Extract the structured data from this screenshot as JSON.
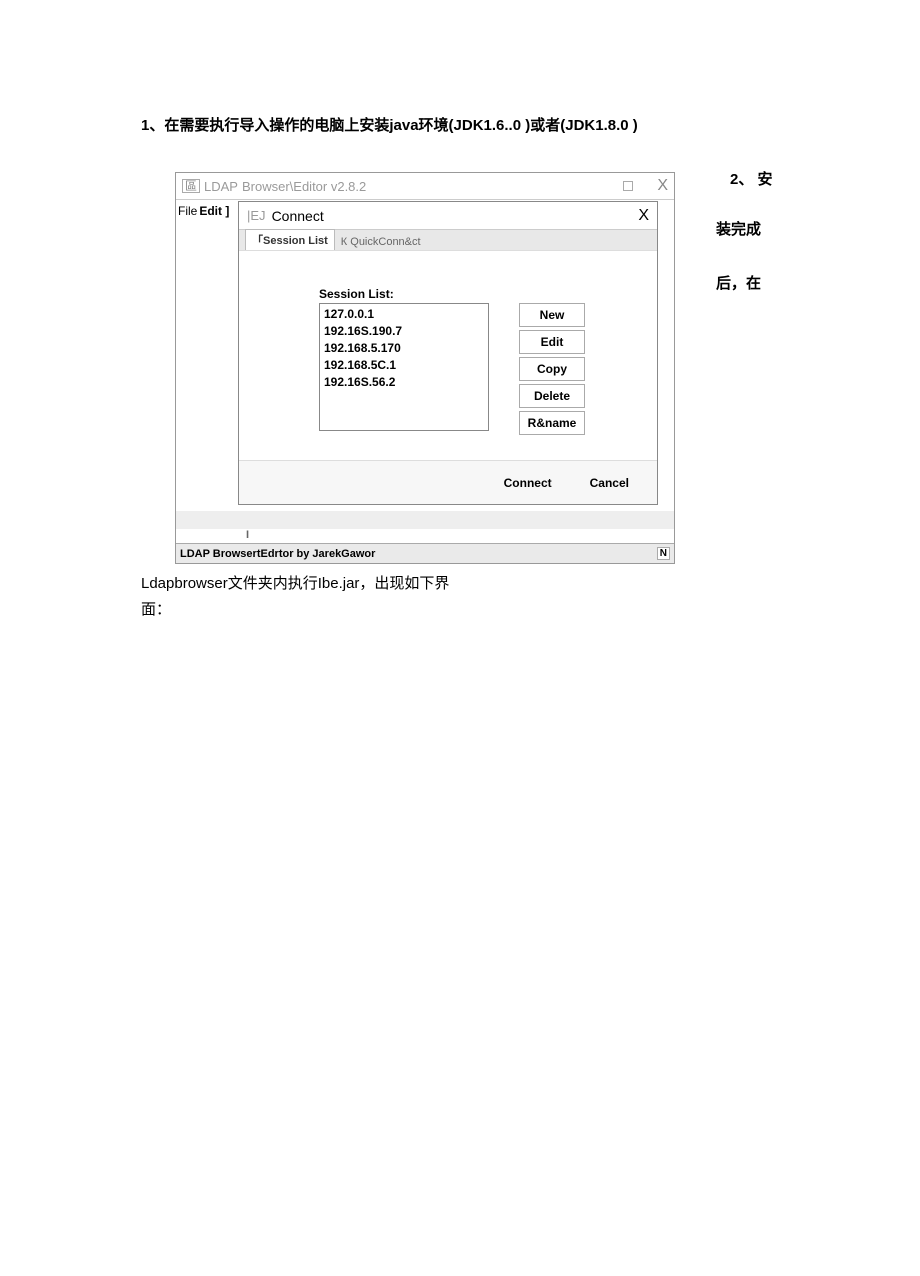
{
  "doc": {
    "line1": "1、在需要执行导入操作的电脑上安装java环境(JDK1.6..0 )或者(JDK1.8.0 )",
    "right_1": "2、 安",
    "right_2": "装完成",
    "right_3": "后，在",
    "below_1": "Ldapbrowser文件夹内执行Ibe.jar，出现如下界",
    "below_2": "面："
  },
  "window": {
    "icon_glyph": "區",
    "title_prefix": "LDAP",
    "title_rest": "Browser\\Editor v2.8.2",
    "close_glyph": "X",
    "menu_file": "File",
    "menu_edit": "Edit ]",
    "status": "LDAP BrowsertEdrtor by JarekGawor",
    "status_right": "N",
    "tick": "I"
  },
  "dialog": {
    "ej": "|EJ",
    "title": "Connect",
    "close": "X",
    "tab_active": "「Session List",
    "tab_other": "К QuickConn&ct",
    "session_label": "Session List:",
    "sessions": [
      "127.0.0.1",
      "192.16S.190.7",
      "192.168.5.170",
      "192.168.5C.1",
      "192.16S.56.2"
    ],
    "buttons": {
      "new_": "New",
      "edit": "Edit",
      "copy": "Copy",
      "delete_": "Delete",
      "rename": "R&name"
    },
    "footer": {
      "connect": "Connect",
      "cancel": "Cancel"
    }
  }
}
